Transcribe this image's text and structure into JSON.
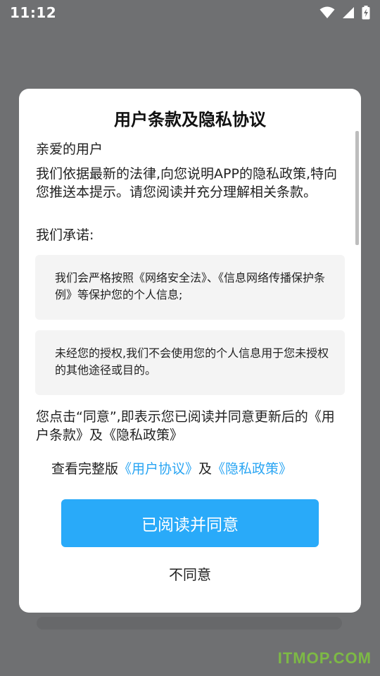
{
  "status_bar": {
    "time": "11:12",
    "icons": [
      "wifi-icon",
      "cellular-signal-icon",
      "battery-charging-icon"
    ]
  },
  "dialog": {
    "title": "用户条款及隐私协议",
    "greeting": "亲爱的用户",
    "intro": "我们依据最新的法律,向您说明APP的隐私政策,特向您推送本提示。请您阅读并充分理解相关条款。",
    "promise_heading": "我们承诺:",
    "promises": [
      "我们会严格按照《网络安全法》、《信息网络传播保护条例》等保护您的个人信息;",
      "未经您的授权,我们不会使用您的个人信息用于您未授权的其他途径或目的。"
    ],
    "consent_text": "您点击“同意”,即表示您已阅读并同意更新后的《用户条款》及《隐私政策》",
    "view_prefix": "查看完整版",
    "user_agreement_link": "《用户协议》",
    "links_separator": "及",
    "privacy_policy_link": "《隐私政策》",
    "agree_button": "已阅读并同意",
    "disagree_button": "不同意"
  },
  "watermark": "ITMOP.COM",
  "colors": {
    "accent": "#29aaf9",
    "link": "#29a5f3",
    "overlay": "#6f7072",
    "watermark": "#7fc241"
  }
}
